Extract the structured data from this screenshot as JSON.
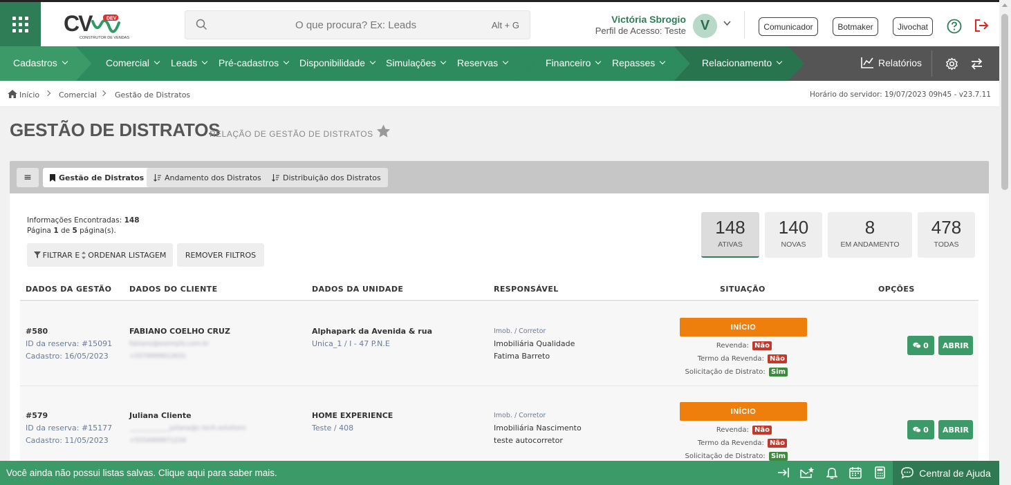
{
  "header": {
    "logo": {
      "brand": "CV",
      "tag": "DEV",
      "tagline": "CONSTRUTOR DE VENDAS"
    },
    "search": {
      "placeholder": "O que procura? Ex: Leads",
      "shortcut": "Alt + G"
    },
    "user": {
      "name": "Victória Sbrogio",
      "profile": "Perfil de Acesso: Teste",
      "initial": "V"
    },
    "buttons": {
      "comunicador": "Comunicador",
      "botmaker": "Botmaker",
      "jivochat": "Jivochat"
    }
  },
  "nav": {
    "items": [
      {
        "label": "Cadastros"
      },
      {
        "label": "Comercial"
      },
      {
        "label": "Leads"
      },
      {
        "label": "Pré-cadastros"
      },
      {
        "label": "Disponibilidade"
      },
      {
        "label": "Simulações"
      },
      {
        "label": "Reservas"
      },
      {
        "label": "Financeiro"
      },
      {
        "label": "Repasses"
      },
      {
        "label": "Relacionamento"
      }
    ],
    "reports": "Relatórios"
  },
  "breadcrumb": {
    "items": [
      "Início",
      "Comercial",
      "Gestão de Distratos"
    ],
    "server_time": "Horário do servidor: 19/07/2023 09h45 - v23.7.11"
  },
  "page": {
    "title": "GESTÃO DE DISTRATOS",
    "subtitle": "RELAÇÃO DE GESTÃO DE DISTRATOS"
  },
  "tabs": {
    "menu_glyph": "≡",
    "items": [
      {
        "label": "Gestão de Distratos"
      },
      {
        "label": "Andamento dos Distratos"
      },
      {
        "label": "Distribuição dos Distratos"
      }
    ]
  },
  "summary": {
    "found_label": "Informações Encontradas:",
    "found_value": "148",
    "page_prefix": "Página",
    "page_current": "1",
    "page_of": "de",
    "page_total": "5",
    "page_suffix": "página(s)."
  },
  "filters": {
    "filter_label": "FILTRAR E",
    "order_label": "ORDENAR LISTAGEM",
    "remove_label": "REMOVER FILTROS"
  },
  "stats": [
    {
      "value": "148",
      "label": "ATIVAS"
    },
    {
      "value": "140",
      "label": "NOVAS"
    },
    {
      "value": "8",
      "label": "EM ANDAMENTO"
    },
    {
      "value": "478",
      "label": "TODAS"
    }
  ],
  "table": {
    "headers": [
      "DADOS DA GESTÃO",
      "DADOS DO CLIENTE",
      "DADOS DA UNIDADE",
      "RESPONSÁVEL",
      "SITUAÇÃO",
      "OPÇÕES"
    ],
    "rows": [
      {
        "id": "#580",
        "reserva": "ID da reserva: #15091",
        "cadastro": "Cadastro: 16/05/2023",
        "cliente": "FABIANO COELHO CRUZ",
        "cliente_email": "fabiano@exemplo.com.br",
        "cliente_fone": "+5579999912631",
        "unidade": "Alphapark da Avenida & rua",
        "unidade_detalhe": "Unica_1 / I - 47 P.N.E",
        "resp_label": "Imob. / Corretor",
        "imobiliaria": "Imobiliária Qualidade",
        "corretor": "Fatima Barreto",
        "situacao": "INÍCIO",
        "revenda_label": "Revenda:",
        "revenda": "Não",
        "termo_label": "Termo da Revenda:",
        "termo": "Não",
        "solicitacao_label": "Solicitação de Distrato:",
        "solicitacao": "Sim",
        "comments": "0",
        "open_label": "ABRIR"
      },
      {
        "id": "#579",
        "reserva": "ID da reserva: #15177",
        "cadastro": "Cadastro: 11/05/2023",
        "cliente": "Juliana Cliente",
        "cliente_email": "_____________juliana@c-tech.solutions",
        "cliente_fone": "+5554999971234",
        "unidade": "HOME EXPERIENCE",
        "unidade_detalhe": "Teste / 408",
        "resp_label": "Imob. / Corretor",
        "imobiliaria": "Imobiliária Nascimento",
        "corretor": "teste autocorretor",
        "situacao": "INÍCIO",
        "revenda_label": "Revenda:",
        "revenda": "Não",
        "termo_label": "Termo da Revenda:",
        "termo": "Não",
        "solicitacao_label": "Solicitação de Distrato:",
        "solicitacao": "Sim",
        "comments": "0",
        "open_label": "ABRIR"
      }
    ]
  },
  "footer": {
    "message": "Você ainda não possui listas salvas. Clique aqui para saber mais.",
    "help_center": "Central de Ajuda"
  },
  "colors": {
    "brand_green": "#2e7d57",
    "status_orange": "#ef7f0c",
    "badge_red": "#c0392b",
    "badge_green": "#3c8a3c"
  }
}
